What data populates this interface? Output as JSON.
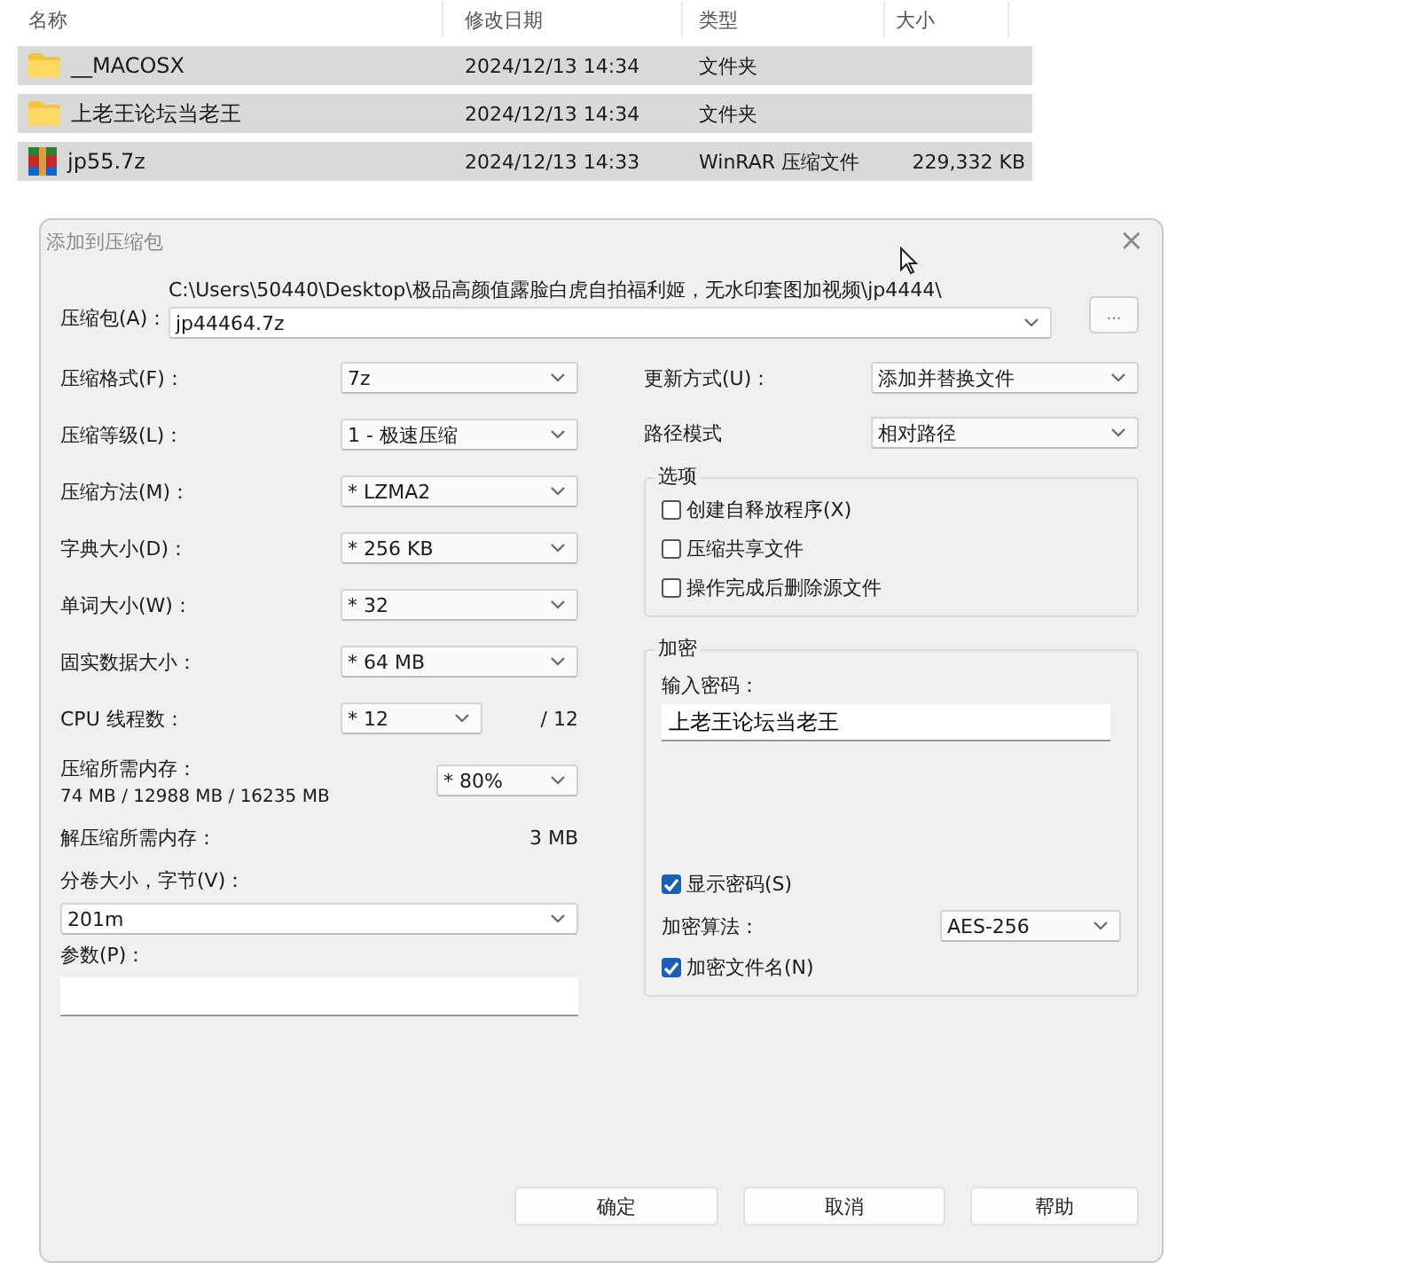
{
  "file_list": {
    "columns": [
      "名称",
      "修改日期",
      "类型",
      "大小"
    ],
    "rows": [
      {
        "kind": "folder",
        "name": "__MACOSX",
        "date": "2024/12/13 14:34",
        "type": "文件夹"
      },
      {
        "kind": "folder",
        "name": "上老王论坛当老王",
        "date": "2024/12/13 14:34",
        "type": "文件夹"
      },
      {
        "kind": "archive",
        "name": "jp55.7z",
        "date": "2024/12/13 14:33",
        "type": "WinRAR 压缩文件",
        "size": "229,332 KB"
      }
    ]
  },
  "dialog": {
    "title": "添加到压缩包",
    "close": "×",
    "archive": {
      "label": "压缩包(A)：",
      "path": "C:\\Users\\50440\\Desktop\\极品高颜值露脸白虎自拍福利姬，无水印套图加视频\\jp4444\\",
      "value": "jp44464.7z",
      "browse": "..."
    },
    "settings": [
      {
        "kind": "combo",
        "label": "压缩格式(F)：",
        "value": "7z"
      },
      {
        "kind": "combo",
        "label": "压缩等级(L)：",
        "value": "1 - 极速压缩"
      },
      {
        "kind": "combo",
        "label": "压缩方法(M)：",
        "value": "* LZMA2"
      },
      {
        "kind": "combo",
        "label": "字典大小(D)：",
        "value": "* 256 KB"
      },
      {
        "kind": "combo",
        "label": "单词大小(W)：",
        "value": "* 32"
      },
      {
        "kind": "combo",
        "label": "固实数据大小：",
        "value": "* 64 MB"
      },
      {
        "kind": "threads",
        "label": "CPU 线程数：",
        "value": "* 12",
        "note": "/ 12"
      },
      {
        "kind": "memory",
        "label": "压缩所需内存：",
        "detail": "74 MB / 12988 MB / 16235 MB",
        "value": "* 80%"
      },
      {
        "kind": "readout",
        "label": "解压缩所需内存：",
        "value": "3 MB"
      },
      {
        "kind": "wide_combo",
        "label": "分卷大小，字节(V)：",
        "value": "201m"
      },
      {
        "kind": "wide_input",
        "label": "参数(P)："
      }
    ],
    "update": {
      "label": "更新方式(U)：",
      "value": "添加并替换文件"
    },
    "path_mode": {
      "label": "路径模式",
      "value": "相对路径"
    },
    "options": {
      "title": "选项",
      "items": [
        {
          "label": "创建自释放程序(X)",
          "checked": false
        },
        {
          "label": "压缩共享文件",
          "checked": false
        },
        {
          "label": "操作完成后删除源文件",
          "checked": false
        }
      ]
    },
    "encryption": {
      "title": "加密",
      "password_label": "输入密码：",
      "password": "上老王论坛当老王",
      "show_password": {
        "label": "显示密码(S)",
        "checked": true
      },
      "algorithm": {
        "label": "加密算法：",
        "value": "AES-256"
      },
      "encrypt_names": {
        "label": "加密文件名(N)",
        "checked": true
      }
    },
    "buttons": [
      "确定",
      "取消",
      "帮助"
    ]
  }
}
